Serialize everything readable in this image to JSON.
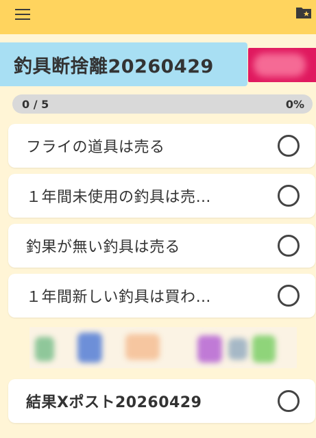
{
  "title": "釣具断捨離20260429",
  "progress": {
    "count_label": "0 / 5",
    "percent_label": "0%",
    "fraction": 0
  },
  "tasks": [
    {
      "label": "フライの道具は売る",
      "done": false
    },
    {
      "label": "１年間未使用の釣具は売…",
      "done": false
    },
    {
      "label": "釣果が無い釣具は売る",
      "done": false
    },
    {
      "label": "１年間新しい釣具は買わ…",
      "done": false
    },
    {
      "label": "結果Xポスト20260429",
      "done": false
    }
  ],
  "icons": {
    "menu": "hamburger-menu-icon",
    "folder": "star-folder-icon",
    "task_check": "circle-outline-icon"
  },
  "colors": {
    "topbar": "#ffd45e",
    "title_bg": "#a8dff3",
    "background": "#fff5d6",
    "ad_badge": "#e0195f"
  }
}
